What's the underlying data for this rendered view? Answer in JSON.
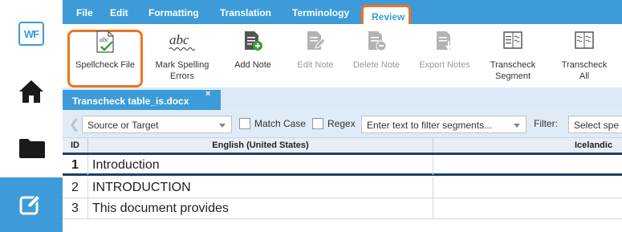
{
  "app": {
    "logo_text": "WF",
    "brand_color": "#3d9bd9",
    "highlight_color": "#f0731e",
    "nav": [
      {
        "name": "home-icon"
      },
      {
        "name": "folder-icon"
      },
      {
        "name": "edit-icon",
        "active": true
      }
    ]
  },
  "menubar": {
    "items": [
      "File",
      "Edit",
      "Formatting",
      "Translation",
      "Terminology",
      "Review"
    ],
    "active": "Review"
  },
  "ribbon": {
    "buttons": [
      {
        "label": "Spellcheck File",
        "icon": "spellcheck-icon",
        "enabled": true,
        "highlighted": true
      },
      {
        "label": "Mark Spelling Errors",
        "icon": "abc-icon",
        "enabled": true
      },
      {
        "label": "Add Note",
        "icon": "add-note-icon",
        "enabled": true
      },
      {
        "label": "Edit Note",
        "icon": "edit-note-icon",
        "enabled": false
      },
      {
        "label": "Delete Note",
        "icon": "delete-note-icon",
        "enabled": false
      },
      {
        "label": "Export Notes",
        "icon": "export-notes-icon",
        "enabled": false
      },
      {
        "label": "Transcheck Segment",
        "icon": "transcheck-segment-icon",
        "enabled": true
      },
      {
        "label": "Transcheck All",
        "icon": "transcheck-all-icon",
        "enabled": true
      }
    ]
  },
  "tab": {
    "label": "Transcheck table_is.docx",
    "close": "×"
  },
  "filterbar": {
    "scope": "Source or Target",
    "match_case": "Match Case",
    "regex": "Regex",
    "filter_placeholder": "Enter text to filter segments...",
    "filter_label": "Filter:",
    "filter_select": "Select spe"
  },
  "grid": {
    "headers": {
      "id": "ID",
      "source": "English (United States)",
      "target": "Icelandic"
    },
    "rows": [
      {
        "id": "1",
        "source": "Introduction",
        "target": ""
      },
      {
        "id": "2",
        "source": "INTRODUCTION",
        "target": ""
      },
      {
        "id": "3",
        "source": "This document provides",
        "target": ""
      }
    ]
  }
}
